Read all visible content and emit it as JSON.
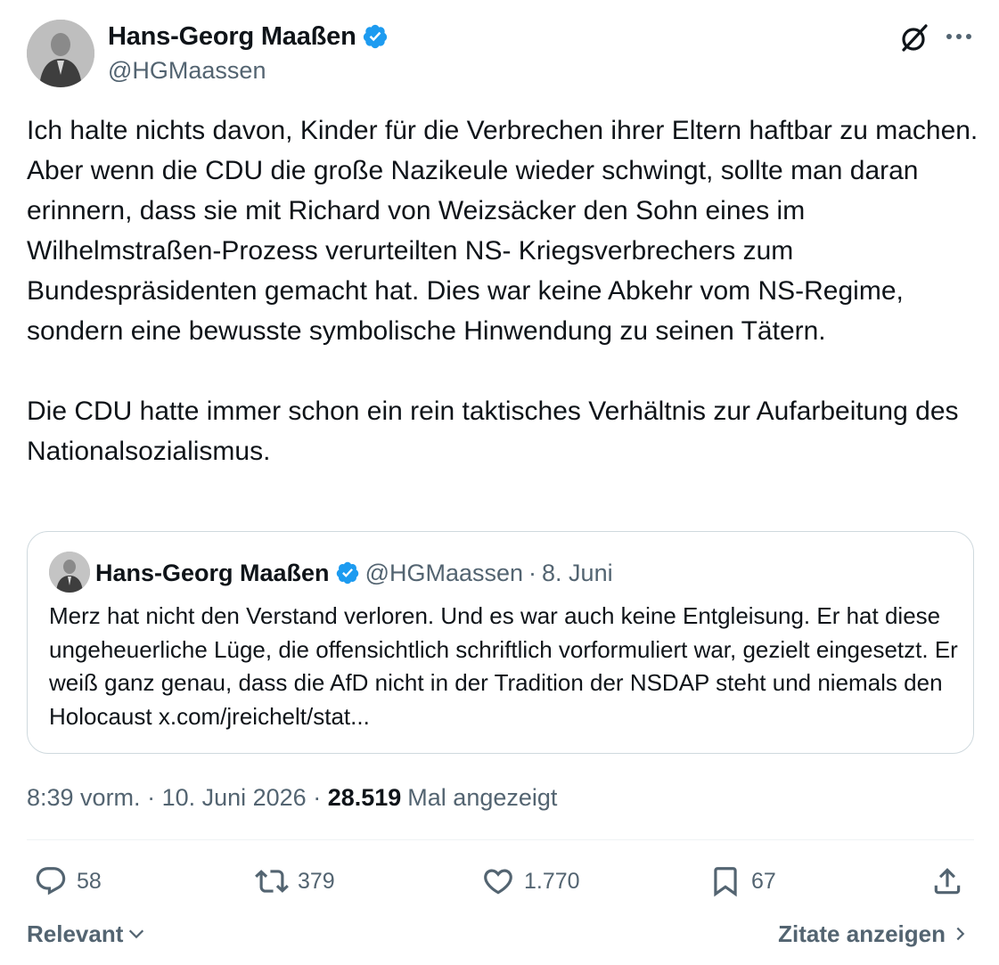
{
  "author": {
    "name": "Hans-Georg Maaßen",
    "handle": "@HGMaassen"
  },
  "tweet": {
    "paragraphs": [
      "Ich halte nichts davon, Kinder für die Verbrechen ihrer Eltern haftbar zu machen. Aber wenn die CDU die große Nazikeule wieder schwingt, sollte man daran erinnern, dass sie mit Richard von Weizsäcker den Sohn eines im Wilhelmstraßen-Prozess verurteilten NS- Kriegsverbrechers zum Bundespräsidenten gemacht hat. Dies war keine Abkehr vom NS-Regime, sondern eine bewusste symbolische Hinwendung zu seinen Tätern.",
      "Die CDU hatte immer schon ein rein taktisches Verhältnis zur Aufarbeitung des Nationalsozialismus."
    ]
  },
  "quote": {
    "name": "Hans-Georg Maaßen",
    "handle": "@HGMaassen",
    "separator": "·",
    "date": "8. Juni",
    "text": "Merz hat nicht den Verstand verloren. Und es war auch keine Entgleisung. Er hat diese ungeheuerliche Lüge, die offensichtlich schriftlich vorformuliert war, gezielt eingesetzt. Er weiß ganz genau, dass die AfD nicht in der Tradition der NSDAP steht und niemals den Holocaust x.com/jreichelt/stat..."
  },
  "meta": {
    "time": "8:39 vorm.",
    "separator": " · ",
    "date": "10. Juni 2026",
    "views_count": "28.519",
    "views_label": "Mal angezeigt"
  },
  "actions": {
    "replies": "58",
    "reposts": "379",
    "likes": "1.770",
    "bookmarks": "67"
  },
  "footer": {
    "sort_label": "Relevant",
    "quotes_label": "Zitate anzeigen"
  },
  "icons": {
    "verified": "verified-badge-icon",
    "grok": "grok-icon",
    "more": "more-icon",
    "reply": "reply-icon",
    "repost": "repost-icon",
    "like": "heart-icon",
    "bookmark": "bookmark-icon",
    "share": "share-icon"
  },
  "colors": {
    "verified_blue": "#1d9bf0",
    "secondary_text": "#536471",
    "primary_text": "#0f1419",
    "border": "#cfd9de"
  }
}
